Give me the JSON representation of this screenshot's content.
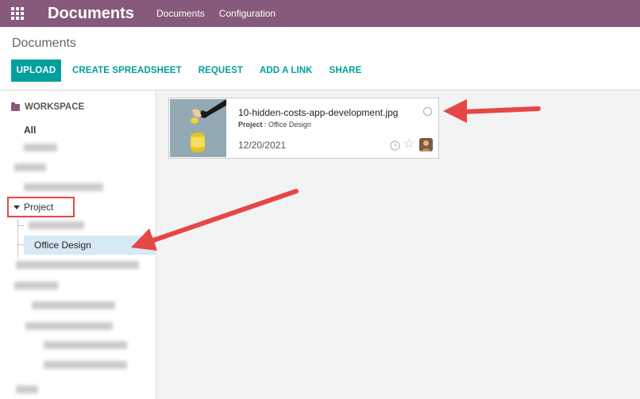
{
  "navbar": {
    "app_title": "Documents",
    "menu": [
      {
        "label": "Documents"
      },
      {
        "label": "Configuration"
      }
    ]
  },
  "control_panel": {
    "breadcrumb": "Documents",
    "buttons": {
      "upload": "UPLOAD",
      "create_spreadsheet": "CREATE SPREADSHEET",
      "request": "REQUEST",
      "add_link": "ADD A LINK",
      "share": "SHARE"
    }
  },
  "sidebar": {
    "header": "WORKSPACE",
    "all": "All",
    "project": "Project",
    "selected": "Office Design"
  },
  "document": {
    "name": "10-hidden-costs-app-development.jpg",
    "folder_label": "Project",
    "folder_value": "Office Design",
    "date": "12/20/2021"
  },
  "colors": {
    "navbar": "#875a7b",
    "accent": "#00a09d",
    "selected": "#d6eaf6",
    "arrow": "#e64646"
  }
}
